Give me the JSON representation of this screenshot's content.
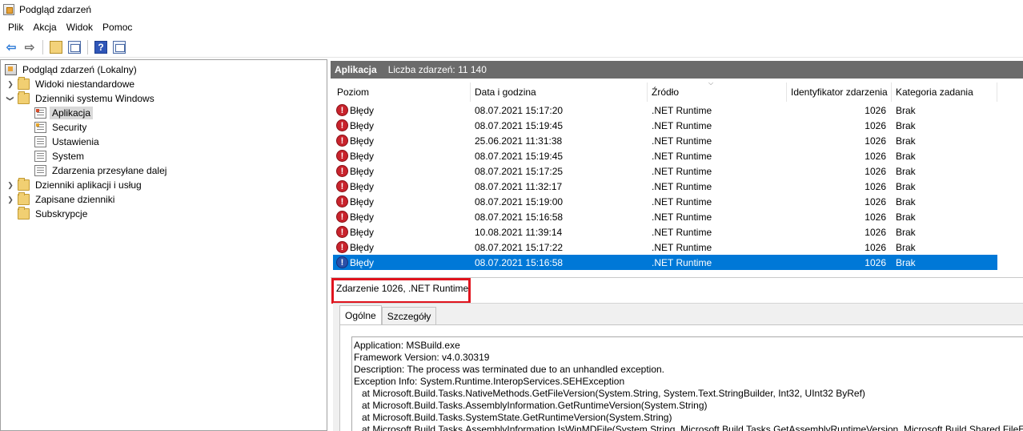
{
  "window": {
    "title": "Podgląd zdarzeń"
  },
  "menu": [
    "Plik",
    "Akcja",
    "Widok",
    "Pomoc"
  ],
  "toolbar_icons": [
    "back-arrow-icon",
    "forward-arrow-icon",
    "folder-up-icon",
    "show-hide-tree-icon",
    "help-icon",
    "action-pane-icon"
  ],
  "tree": {
    "root": "Podgląd zdarzeń (Lokalny)",
    "custom_views": "Widoki niestandardowe",
    "windows_logs": "Dzienniki systemu Windows",
    "logs": [
      "Aplikacja",
      "Security",
      "Ustawienia",
      "System",
      "Zdarzenia przesyłane dalej"
    ],
    "app_logs": "Dzienniki aplikacji i usług",
    "saved_logs": "Zapisane dzienniki",
    "subscriptions": "Subskrypcje"
  },
  "header": {
    "title": "Aplikacja",
    "count": "Liczba zdarzeń: 11 140"
  },
  "columns": [
    "Poziom",
    "Data i godzina",
    "Źródło",
    "Identyfikator zdarzenia",
    "Kategoria zadania"
  ],
  "rows": [
    {
      "level": "Błędy",
      "date": "08.07.2021 15:17:20",
      "source": ".NET Runtime",
      "id": "1026",
      "category": "Brak"
    },
    {
      "level": "Błędy",
      "date": "08.07.2021 15:19:45",
      "source": ".NET Runtime",
      "id": "1026",
      "category": "Brak"
    },
    {
      "level": "Błędy",
      "date": "25.06.2021 11:31:38",
      "source": ".NET Runtime",
      "id": "1026",
      "category": "Brak"
    },
    {
      "level": "Błędy",
      "date": "08.07.2021 15:19:45",
      "source": ".NET Runtime",
      "id": "1026",
      "category": "Brak"
    },
    {
      "level": "Błędy",
      "date": "08.07.2021 15:17:25",
      "source": ".NET Runtime",
      "id": "1026",
      "category": "Brak"
    },
    {
      "level": "Błędy",
      "date": "08.07.2021 11:32:17",
      "source": ".NET Runtime",
      "id": "1026",
      "category": "Brak"
    },
    {
      "level": "Błędy",
      "date": "08.07.2021 15:19:00",
      "source": ".NET Runtime",
      "id": "1026",
      "category": "Brak"
    },
    {
      "level": "Błędy",
      "date": "08.07.2021 15:16:58",
      "source": ".NET Runtime",
      "id": "1026",
      "category": "Brak"
    },
    {
      "level": "Błędy",
      "date": "10.08.2021 11:39:14",
      "source": ".NET Runtime",
      "id": "1026",
      "category": "Brak"
    },
    {
      "level": "Błędy",
      "date": "08.07.2021 15:17:22",
      "source": ".NET Runtime",
      "id": "1026",
      "category": "Brak"
    },
    {
      "level": "Błędy",
      "date": "08.07.2021 15:16:58",
      "source": ".NET Runtime",
      "id": "1026",
      "category": "Brak"
    }
  ],
  "selected_row": 10,
  "detail": {
    "title": "Zdarzenie 1026, .NET Runtime",
    "tabs": [
      "Ogólne",
      "Szczegóły"
    ],
    "lines": [
      "Application: MSBuild.exe",
      "Framework Version: v4.0.30319",
      "Description: The process was terminated due to an unhandled exception.",
      "Exception Info: System.Runtime.InteropServices.SEHException",
      "   at Microsoft.Build.Tasks.NativeMethods.GetFileVersion(System.String, System.Text.StringBuilder, Int32, UInt32 ByRef)",
      "   at Microsoft.Build.Tasks.AssemblyInformation.GetRuntimeVersion(System.String)",
      "   at Microsoft.Build.Tasks.SystemState.GetRuntimeVersion(System.String)",
      "   at Microsoft.Build.Tasks.AssemblyInformation.IsWinMDFile(System.String, Microsoft.Build.Tasks.GetAssemblyRuntimeVersion, Microsoft.Build.Shared.FileExis"
    ]
  },
  "colors": {
    "selection": "#0078d7",
    "header_bar": "#6b6b6b",
    "error": "#c8232c",
    "highlight": "#e0141e"
  }
}
